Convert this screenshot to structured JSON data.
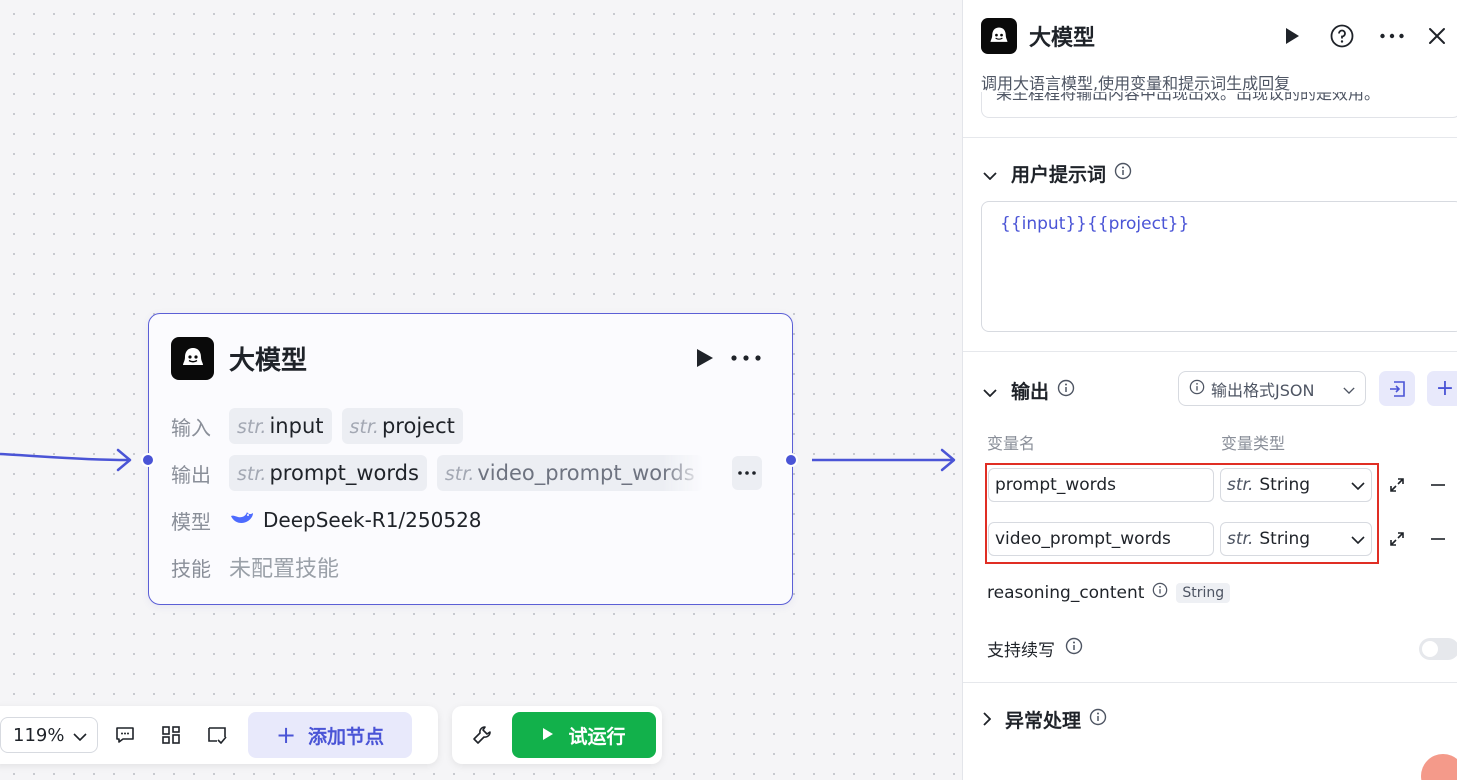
{
  "node": {
    "title": "大模型",
    "input_label": "输入",
    "inputs": [
      {
        "type": "str.",
        "name": "input"
      },
      {
        "type": "str.",
        "name": "project"
      }
    ],
    "output_label": "输出",
    "outputs": [
      {
        "type": "str.",
        "name": "prompt_words"
      },
      {
        "type": "str.",
        "name": "video_prompt_words"
      }
    ],
    "model_label": "模型",
    "model_name": "DeepSeek-R1/250528",
    "skill_label": "技能",
    "skill_value": "未配置技能"
  },
  "toolbar": {
    "zoom": "119%",
    "add_node": "添加节点",
    "run": "试运行"
  },
  "panel": {
    "title": "大模型",
    "description": "调用大语言模型,使用变量和提示词生成回复",
    "clipped_text": "果生程程将输出内容中出现出效。出现议的的是效用。",
    "user_prompt_title": "用户提示词",
    "user_prompt_value": "{{input}}{{project}}",
    "output_title": "输出",
    "output_format": "输出格式JSON",
    "col_var_name": "变量名",
    "col_var_type": "变量类型",
    "output_vars": [
      {
        "name": "prompt_words",
        "type_prefix": "str.",
        "type": "String"
      },
      {
        "name": "video_prompt_words",
        "type_prefix": "str.",
        "type": "String"
      }
    ],
    "reasoning_name": "reasoning_content",
    "reasoning_type": "String",
    "continue_label": "支持续写",
    "exception_title": "异常处理"
  },
  "colors": {
    "accent": "#4a54d6",
    "run_green": "#12b14b",
    "highlight_red": "#e02e24"
  }
}
